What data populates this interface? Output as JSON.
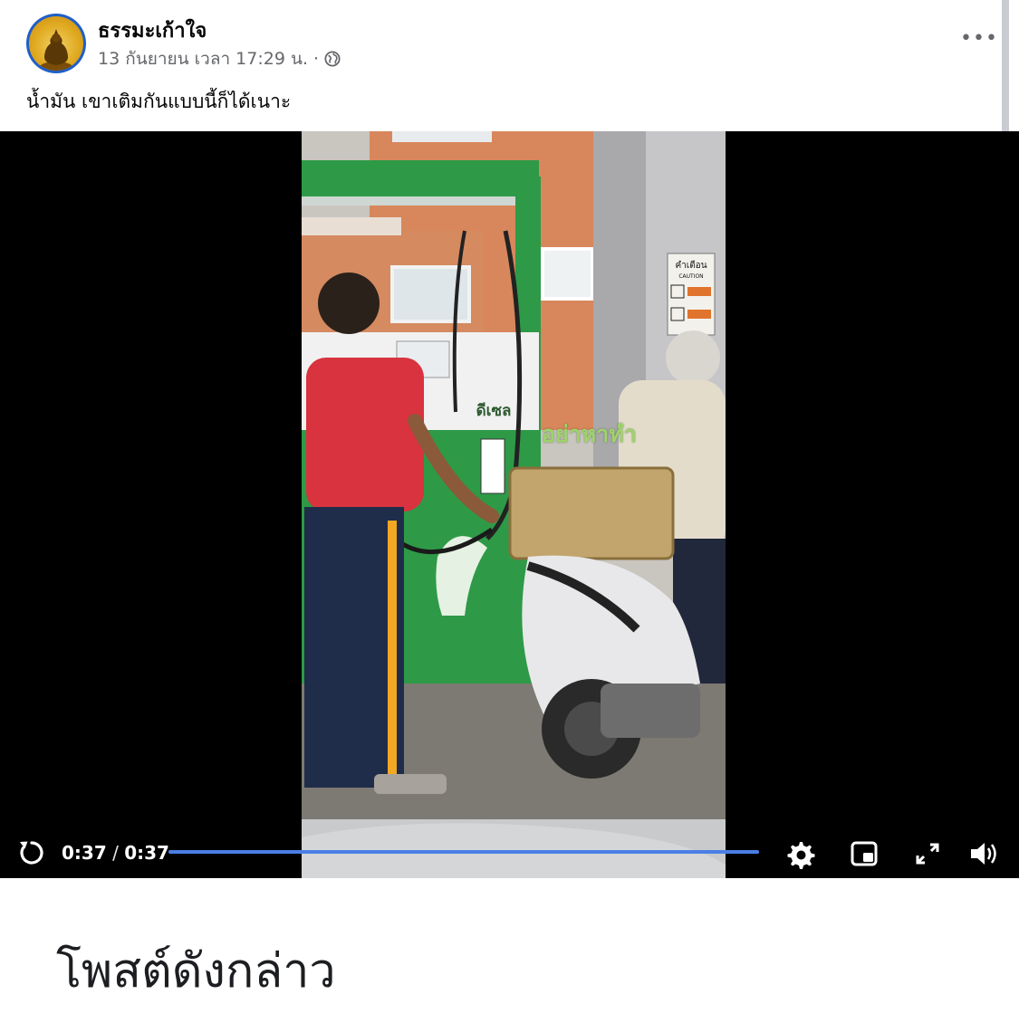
{
  "post": {
    "page_name": "ธรรมะเก้าใจ",
    "timestamp": "13 กันยายน เวลา 17:29 น.",
    "separator": "·",
    "privacy_icon": "globe-icon",
    "more_label": "•••",
    "text": "น้ำมัน เขาเติมกันแบบนี้ก็ได้เนาะ"
  },
  "video": {
    "watermark": "อย่าหาทำ",
    "pump_label": "ดีเซล",
    "sign_label": "คำเตือน",
    "sign_sublabel": "CAUTION",
    "current_time": "0:37",
    "time_separator": " / ",
    "duration": "0:37",
    "progress": 1.0,
    "icons": [
      "replay-icon",
      "settings-icon",
      "miniplayer-icon",
      "fullscreen-icon",
      "volume-icon"
    ]
  },
  "caption": "โพสต์ดังกล่าว",
  "colors": {
    "progress": "#4a7fe5",
    "avatar_ring": "#1f5fc8",
    "pump_green": "#2e9a47",
    "watermark": "#9ed36a"
  }
}
